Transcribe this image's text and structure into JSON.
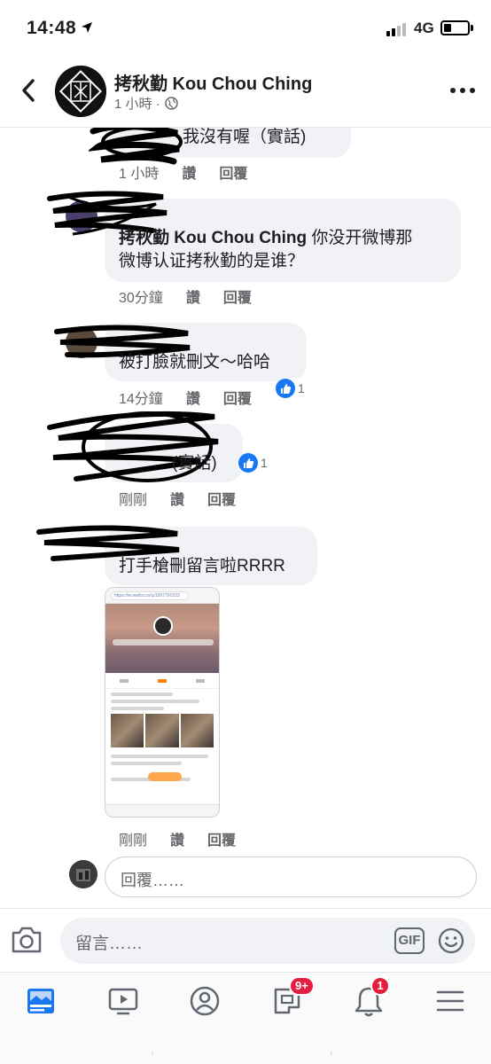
{
  "status_bar": {
    "time": "14:48",
    "network": "4G"
  },
  "header": {
    "page_name": "拷秋勤 Kou Chou Ching",
    "post_time": "1 小時 · ",
    "back_icon": "chevron-left-icon",
    "more_icon": "more-dots-icon"
  },
  "comments": [
    {
      "text": "我沒有喔（實話)",
      "time": "1 小時",
      "like": "讚",
      "reply": "回覆"
    },
    {
      "author": "拷秋勤 Kou Chou Ching",
      "text_line1": " 你没开微博那",
      "text_line2": "微博认证拷秋勤的是谁？",
      "time": "30分鐘",
      "like": "讚",
      "reply": "回覆"
    },
    {
      "text": "被打臉就刪文～哈哈",
      "time": "14分鐘",
      "like": "讚",
      "reply": "回覆",
      "reactions": "1"
    },
    {
      "text": "(實話)",
      "time": "剛剛",
      "like": "讚",
      "reply": "回覆",
      "reactions": "1"
    },
    {
      "text": "打手槍刪留言啦RRRR",
      "time": "剛剛",
      "like": "讚",
      "reply": "回覆"
    }
  ],
  "screenshot_url": "https://m.weibo.cn/u/1997791533",
  "reply_box": {
    "placeholder": "回覆……"
  },
  "composer": {
    "placeholder": "留言……",
    "gif_label": "GIF"
  },
  "tabbar": {
    "groups_badge": "9+",
    "notifications_badge": "1",
    "home_left": "‹",
    "home_right": "›"
  },
  "colors": {
    "accent": "#1877f2",
    "badge": "#e41e3f",
    "bubble": "#f0f2f5"
  }
}
